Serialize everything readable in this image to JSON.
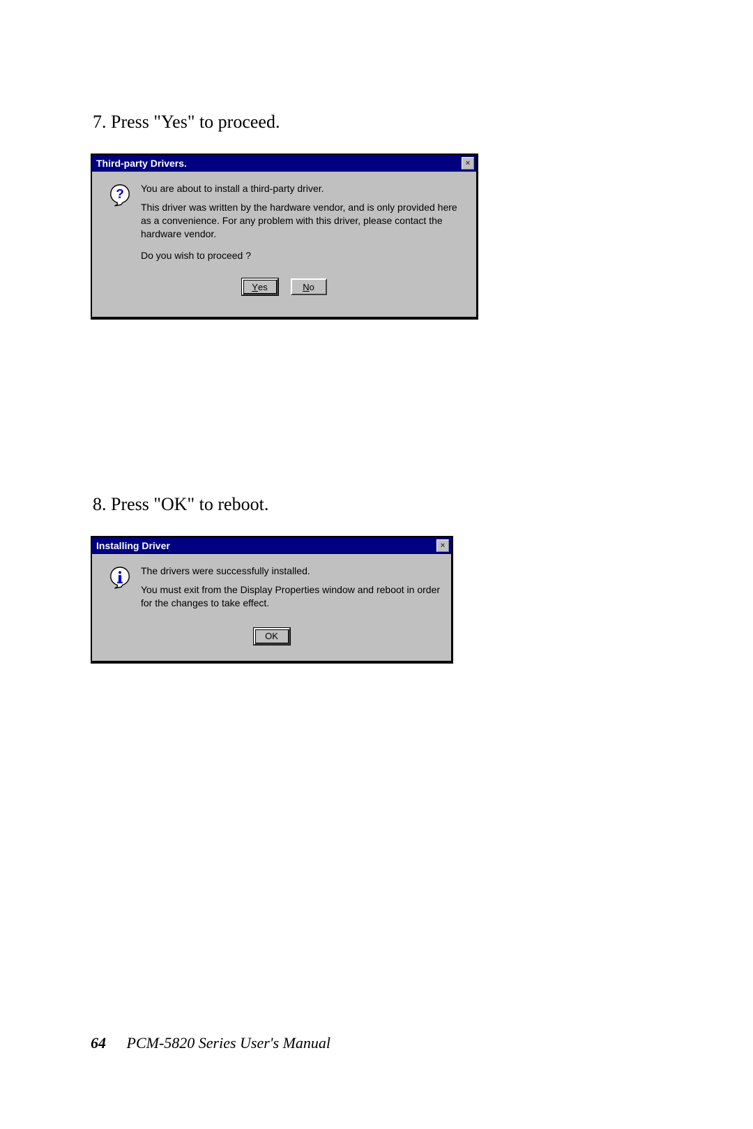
{
  "steps": {
    "step7": "7.  Press \"Yes\" to proceed.",
    "step8": "8.  Press \"OK\" to reboot."
  },
  "dialog1": {
    "title": "Third-party Drivers.",
    "close": "×",
    "line1": "You are about to install a third-party driver.",
    "block": "This driver was written by the hardware vendor, and is only provided here as a convenience.  For any problem with this driver, please contact the hardware vendor.",
    "line3": "Do you wish to proceed ?",
    "btnYes_prefix": "Y",
    "btnYes_suffix": "es",
    "btnNo_prefix": "N",
    "btnNo_suffix": "o"
  },
  "dialog2": {
    "title": "Installing Driver",
    "close": "×",
    "line1": "The drivers were successfully installed.",
    "block": "You must exit from the Display Properties window and reboot in order for the changes to take effect.",
    "btnOK": "OK"
  },
  "footer": {
    "page": "64",
    "title": "PCM-5820 Series  User's Manual"
  }
}
